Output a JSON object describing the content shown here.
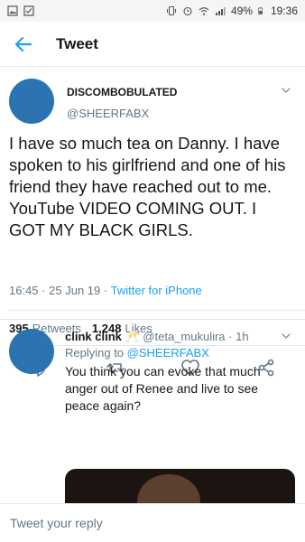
{
  "status_bar": {
    "battery": "49%",
    "time": "19:36"
  },
  "app_bar": {
    "title": "Tweet"
  },
  "tweet": {
    "display_name": "DISCOMBOBULATED",
    "handle": "@SHEERFABX",
    "text": "I have so much tea on Danny.  I have spoken to his girlfriend and one of his friend they have reached out to me.  YouTube VIDEO COMING OUT. I GOT MY BLACK GIRLS.",
    "time": "16:45",
    "separator": "·",
    "date": "25 Jun 19",
    "source": "Twitter for iPhone",
    "retweets_count": "395",
    "retweets_label": "Retweets",
    "likes_count": "1,248",
    "likes_label": "Likes"
  },
  "reply": {
    "display_name": "clink clink 🥂",
    "handle": "@teta_mukulira",
    "age": "· 1h",
    "replying_prefix": "Replying to",
    "replying_to": "@SHEERFABX",
    "text": "You think you can evoke that much anger out of Renee and live to see peace again?"
  },
  "composer": {
    "placeholder": "Tweet your reply"
  },
  "colors": {
    "accent": "#1da1f2",
    "avatar": "#2b74b1",
    "muted": "#657786"
  }
}
